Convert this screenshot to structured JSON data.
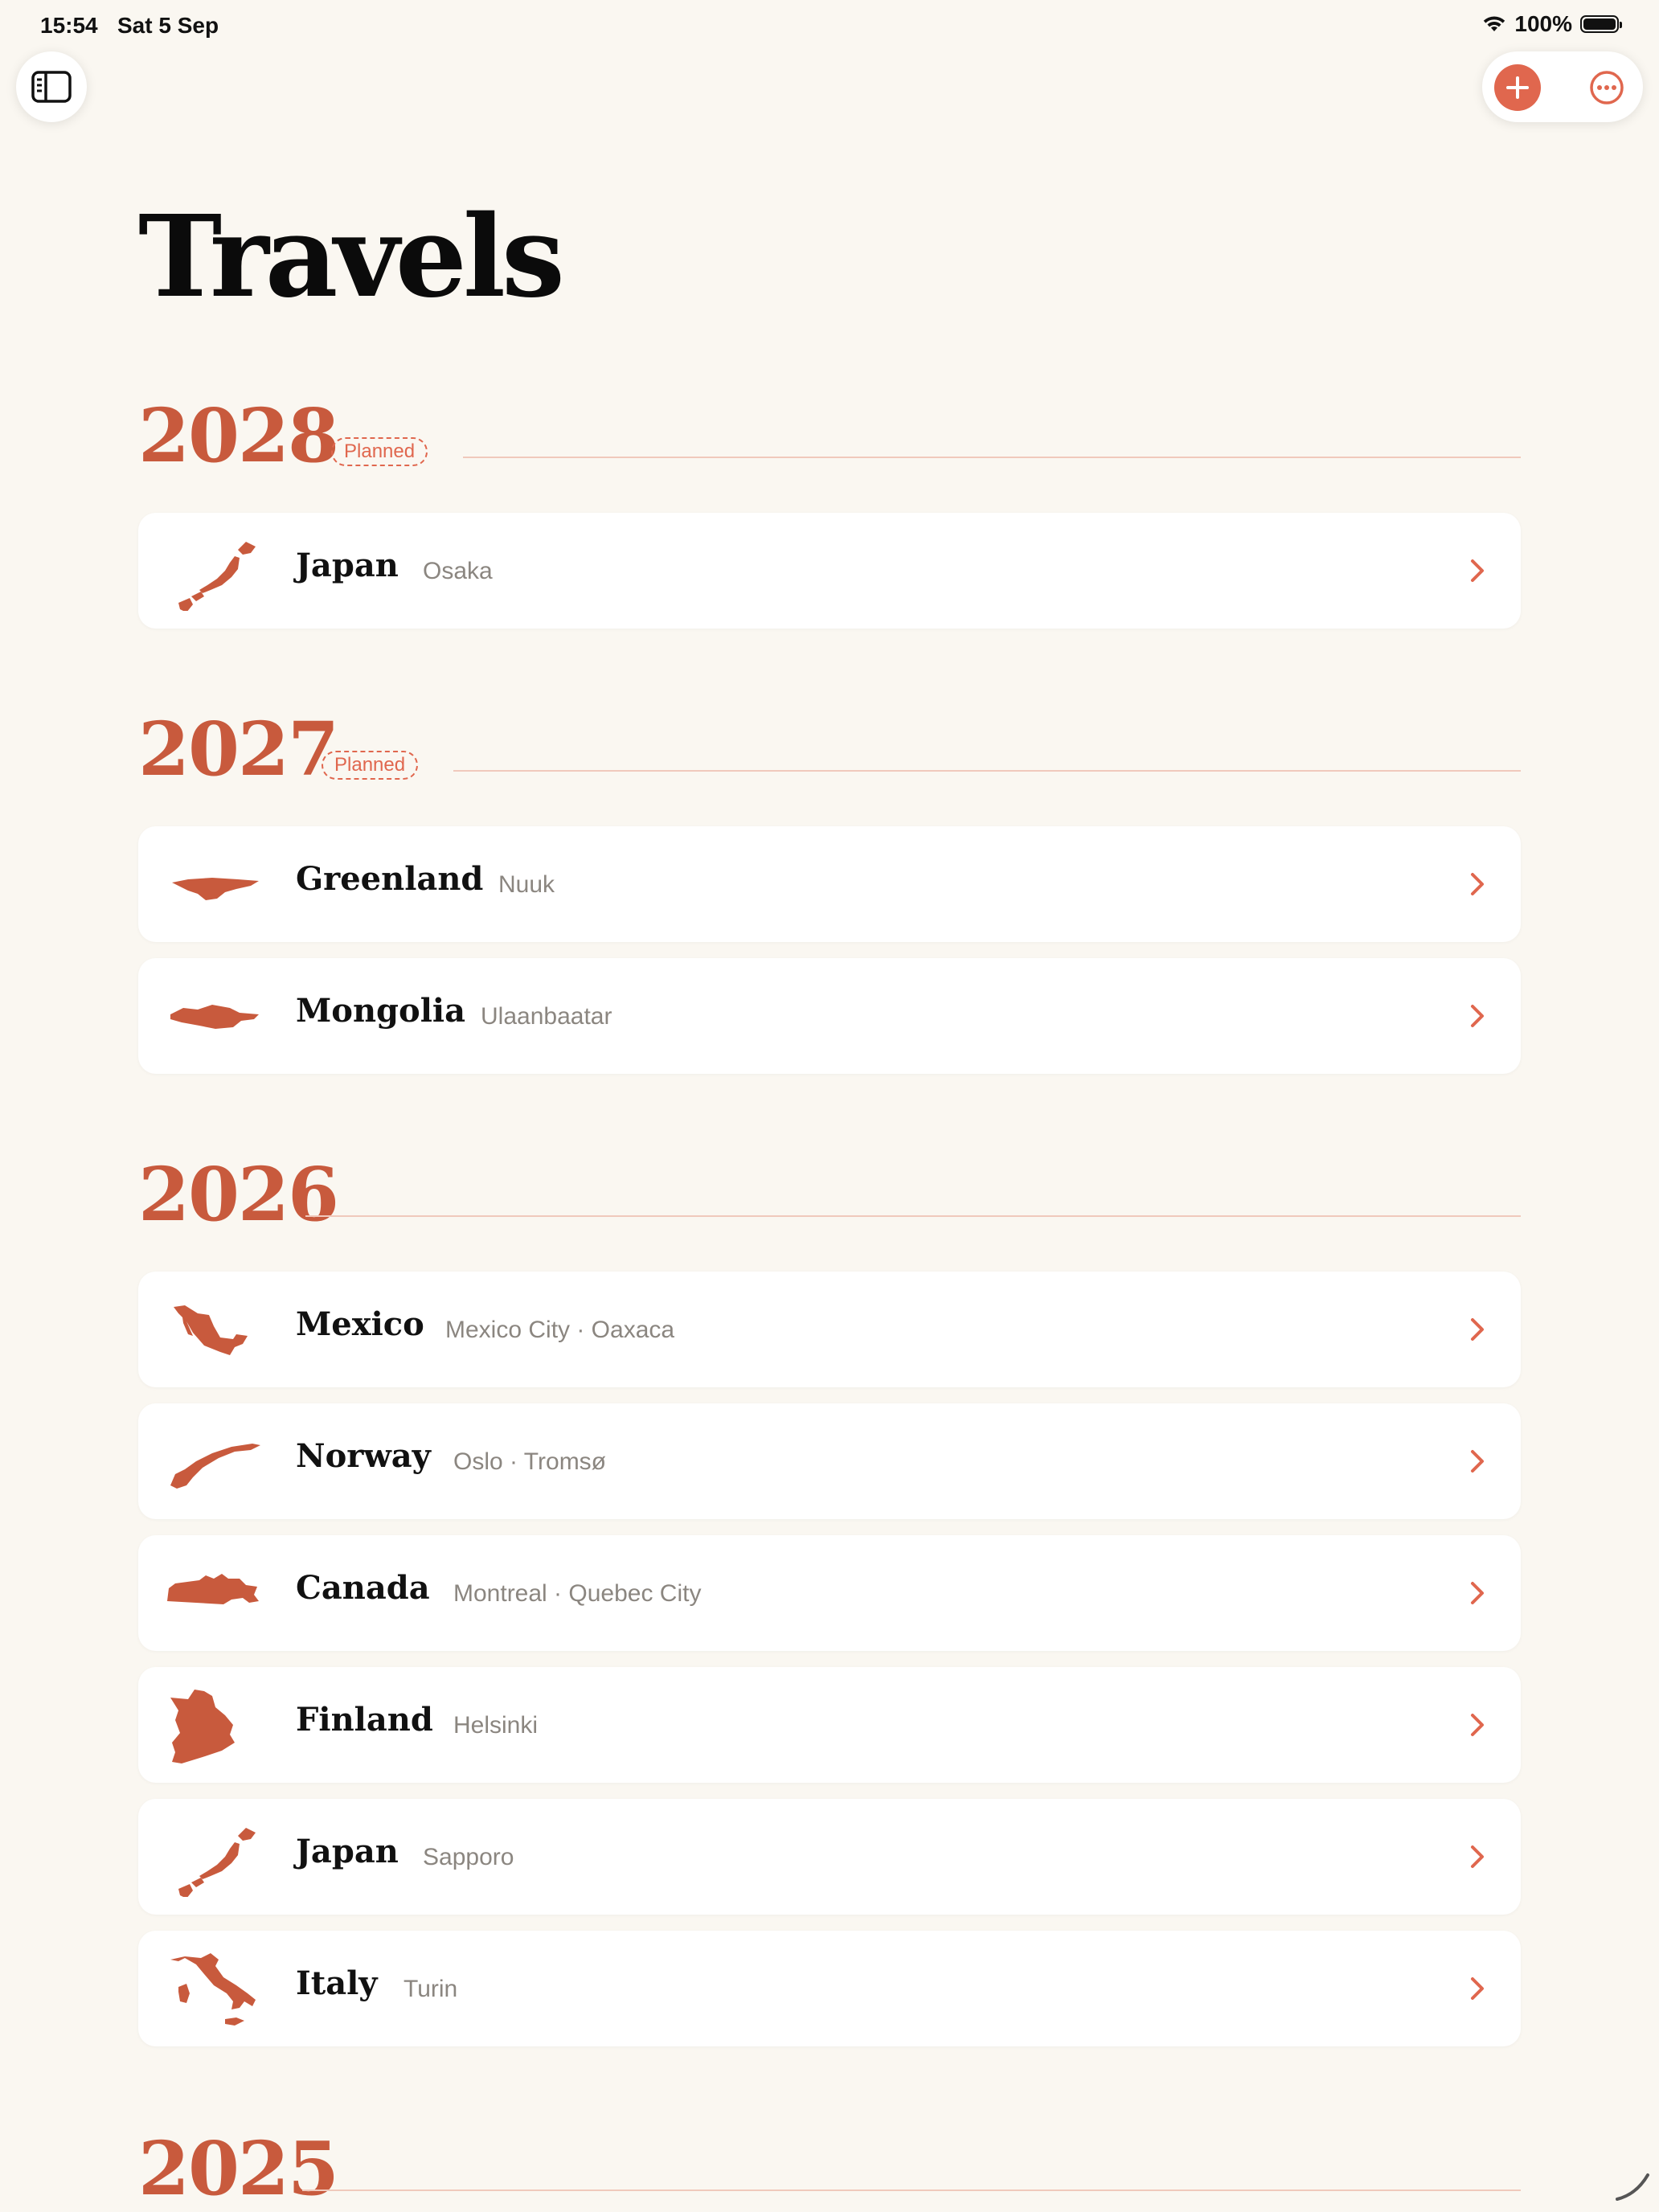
{
  "status_bar": {
    "time": "15:54",
    "date": "Sat 5 Sep",
    "battery": "100%"
  },
  "toolbar": {
    "sidebar_icon": "sidebar-icon",
    "add_icon": "plus-icon",
    "more_icon": "ellipsis-icon"
  },
  "title": "Travels",
  "colors": {
    "accent": "#c85a3d",
    "accent_light": "#e0674e",
    "background": "#faf7f1",
    "card": "#ffffff",
    "muted_text": "#8b8680"
  },
  "years": [
    {
      "year": "2028",
      "badge": "Planned",
      "trips": [
        {
          "country": "Japan",
          "cities": "Osaka"
        }
      ]
    },
    {
      "year": "2027",
      "badge": "Planned",
      "trips": [
        {
          "country": "Greenland",
          "cities": "Nuuk"
        },
        {
          "country": "Mongolia",
          "cities": "Ulaanbaatar"
        }
      ]
    },
    {
      "year": "2026",
      "trips": [
        {
          "country": "Mexico",
          "cities": "Mexico City · Oaxaca"
        },
        {
          "country": "Norway",
          "cities": "Oslo · Tromsø"
        },
        {
          "country": "Canada",
          "cities": "Montreal · Quebec City"
        },
        {
          "country": "Finland",
          "cities": "Helsinki"
        },
        {
          "country": "Japan",
          "cities": "Sapporo"
        },
        {
          "country": "Italy",
          "cities": "Turin"
        }
      ]
    },
    {
      "year": "2025",
      "trips": []
    }
  ]
}
